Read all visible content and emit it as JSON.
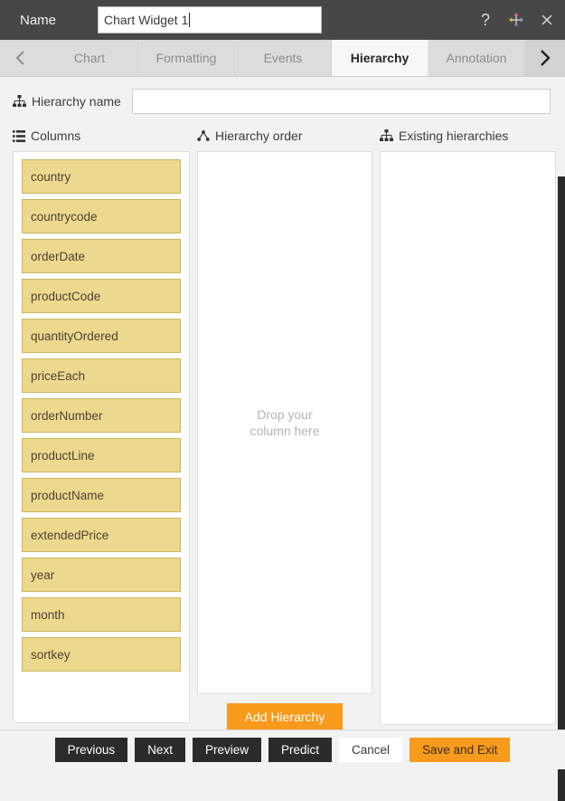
{
  "titlebar": {
    "name_label": "Name",
    "widget_name_value": "Chart Widget 1",
    "help_icon": "question-mark-icon",
    "move_icon": "move-arrows-icon",
    "close_icon": "close-icon"
  },
  "tabbar": {
    "prev_arrow_icon": "chevron-left-icon",
    "next_arrow_icon": "chevron-right-icon",
    "tabs": [
      {
        "label": "Chart",
        "active": false
      },
      {
        "label": "Formatting",
        "active": false
      },
      {
        "label": "Events",
        "active": false
      },
      {
        "label": "Hierarchy",
        "active": true
      },
      {
        "label": "Annotation",
        "active": false
      }
    ]
  },
  "hierarchy_name": {
    "icon": "sitemap-icon",
    "label": "Hierarchy name",
    "value": "",
    "placeholder": ""
  },
  "panels": {
    "columns": {
      "icon": "list-icon",
      "title": "Columns",
      "items": [
        "country",
        "countrycode",
        "orderDate",
        "productCode",
        "quantityOrdered",
        "priceEach",
        "orderNumber",
        "productLine",
        "productName",
        "extendedPrice",
        "year",
        "month",
        "sortkey"
      ]
    },
    "hierarchy_order": {
      "icon": "tree-branch-icon",
      "title": "Hierarchy order",
      "drop_placeholder": "Drop your column here",
      "add_button_label": "Add Hierarchy",
      "items": []
    },
    "existing_hierarchies": {
      "icon": "sitemap-icon",
      "title": "Existing hierarchies",
      "items": []
    }
  },
  "footer": {
    "buttons": [
      {
        "label": "Previous",
        "style": "dark"
      },
      {
        "label": "Next",
        "style": "dark"
      },
      {
        "label": "Preview",
        "style": "dark"
      },
      {
        "label": "Predict",
        "style": "dark"
      },
      {
        "label": "Cancel",
        "style": "light"
      },
      {
        "label": "Save and Exit",
        "style": "orange"
      }
    ]
  },
  "colors": {
    "titlebar_bg": "#474747",
    "accent_orange": "#f89a1c",
    "column_item_bg": "#ecd98d",
    "column_item_border": "#c9b761",
    "dark_button": "#2b2b2b",
    "page_bg": "#f2f2f2"
  }
}
